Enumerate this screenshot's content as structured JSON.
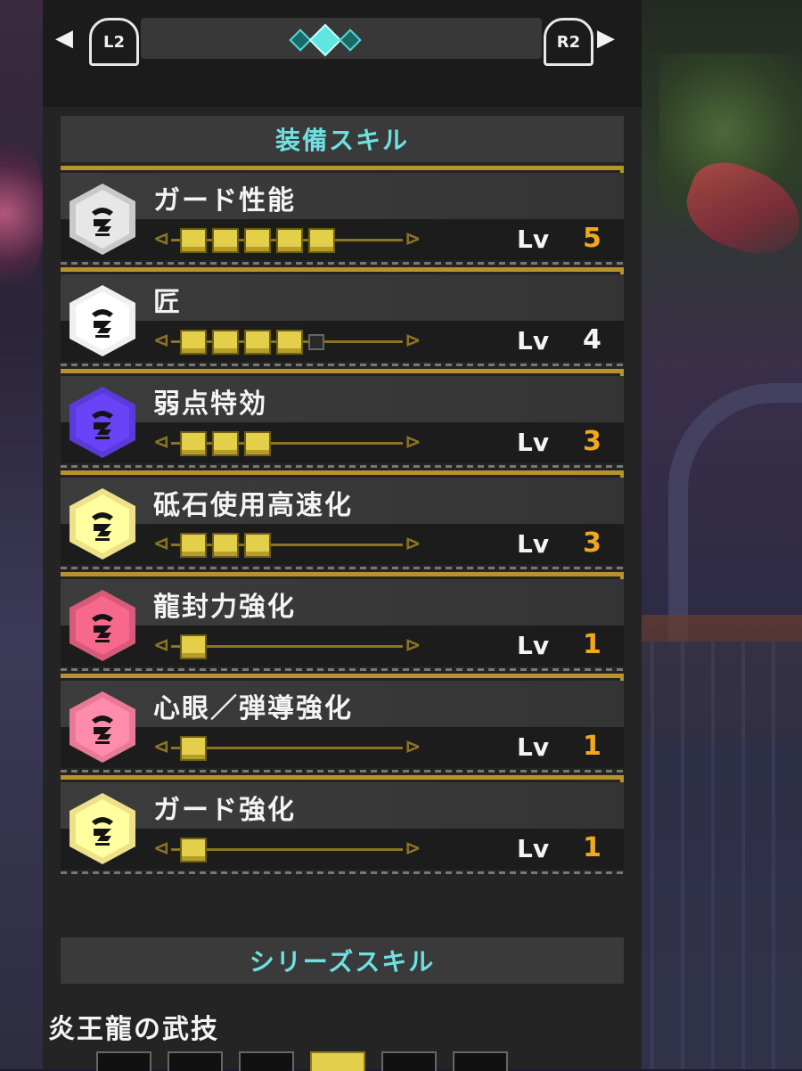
{
  "nav": {
    "left_arrow": "◀",
    "right_arrow": "▶",
    "l2": "L2",
    "r2": "R2",
    "page_dots": 3,
    "active_dot": 2
  },
  "equip_header": "装備スキル",
  "lv_label": "Lv",
  "skills": [
    {
      "name": "ガード性能",
      "level": "5",
      "max": 5,
      "color": "#c9c9c9",
      "lv_color": "#f3a81c"
    },
    {
      "name": "匠",
      "level": "4",
      "max": 5,
      "color": "#f0f0f0",
      "lv_color": "#f4f4f4"
    },
    {
      "name": "弱点特効",
      "level": "3",
      "max": 3,
      "color": "#5a3ad8",
      "lv_color": "#f3a81c"
    },
    {
      "name": "砥石使用高速化",
      "level": "3",
      "max": 3,
      "color": "#efe08a",
      "lv_color": "#f3a81c"
    },
    {
      "name": "龍封力強化",
      "level": "1",
      "max": 1,
      "color": "#d85a7a",
      "lv_color": "#f3a81c"
    },
    {
      "name": "心眼／弾導強化",
      "level": "1",
      "max": 1,
      "color": "#e87a96",
      "lv_color": "#f3a81c"
    },
    {
      "name": "ガード強化",
      "level": "1",
      "max": 1,
      "color": "#efe08a",
      "lv_color": "#f3a81c"
    }
  ],
  "series_header": "シリーズスキル",
  "series_skill": "炎王龍の武技"
}
